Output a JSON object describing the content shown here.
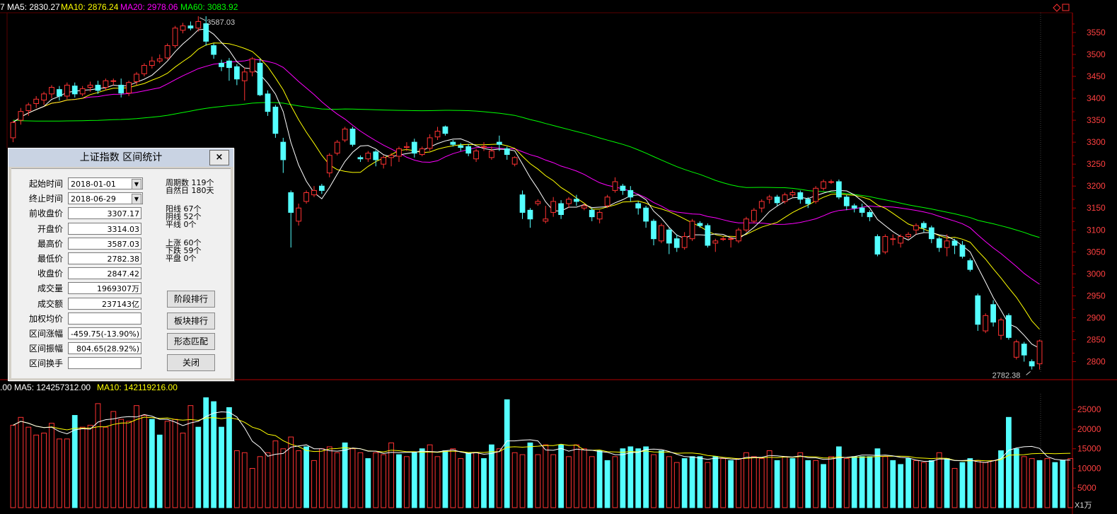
{
  "header": {
    "ma5": "7 MA5: 2830.27",
    "ma10": "MA10: 2876.24",
    "ma20": "MA20: 2978.06",
    "ma60": "MA60: 3083.92",
    "volume_line": ".00 MA5: 124257312.00",
    "volume_ma10": "MA10: 142119216.00",
    "unit_label": "X1万"
  },
  "colors": {
    "up": "#ff3232",
    "down": "#54ffff",
    "ma5": "#ffffff",
    "ma10": "#ffff00",
    "ma20": "#ff00ff",
    "ma60": "#00ff00",
    "axis": "#b00000",
    "grid": "#5a0000"
  },
  "chart_data": {
    "type": "candlestick",
    "price_axis_ticks": [
      3550,
      3500,
      3450,
      3400,
      3350,
      3300,
      3250,
      3200,
      3150,
      3100,
      3050,
      3000,
      2950,
      2900,
      2850,
      2800
    ],
    "volume_axis_ticks": [
      25000,
      20000,
      15000,
      10000,
      5000
    ],
    "volume_unit": "万",
    "annotations": {
      "high": "3587.03",
      "low": "2782.38"
    },
    "price_ylim": [
      2775,
      3595
    ],
    "volume_ylim": [
      0,
      29000
    ],
    "candles": [
      [
        3310,
        3345,
        3300,
        3348
      ],
      [
        3350,
        3370,
        3340,
        3378
      ],
      [
        3372,
        3385,
        3360,
        3390
      ],
      [
        3388,
        3398,
        3378,
        3405
      ],
      [
        3396,
        3410,
        3385,
        3415
      ],
      [
        3410,
        3425,
        3400,
        3430
      ],
      [
        3420,
        3405,
        3395,
        3428
      ],
      [
        3405,
        3430,
        3398,
        3436
      ],
      [
        3428,
        3410,
        3402,
        3436
      ],
      [
        3410,
        3422,
        3405,
        3428
      ],
      [
        3425,
        3430,
        3415,
        3438
      ],
      [
        3430,
        3418,
        3410,
        3440
      ],
      [
        3425,
        3440,
        3418,
        3445
      ],
      [
        3440,
        3440,
        3430,
        3445
      ],
      [
        3430,
        3412,
        3402,
        3445
      ],
      [
        3412,
        3436,
        3405,
        3440
      ],
      [
        3438,
        3455,
        3430,
        3460
      ],
      [
        3456,
        3475,
        3450,
        3480
      ],
      [
        3475,
        3485,
        3468,
        3495
      ],
      [
        3485,
        3490,
        3480,
        3500
      ],
      [
        3492,
        3520,
        3488,
        3525
      ],
      [
        3520,
        3560,
        3515,
        3565
      ],
      [
        3555,
        3565,
        3548,
        3572
      ],
      [
        3565,
        3560,
        3555,
        3575
      ],
      [
        3560,
        3575,
        3552,
        3587
      ],
      [
        3570,
        3530,
        3520,
        3587
      ],
      [
        3520,
        3500,
        3490,
        3525
      ],
      [
        3480,
        3472,
        3462,
        3488
      ],
      [
        3485,
        3470,
        3440,
        3492
      ],
      [
        3472,
        3444,
        3430,
        3478
      ],
      [
        3440,
        3460,
        3395,
        3470
      ],
      [
        3460,
        3490,
        3450,
        3494
      ],
      [
        3480,
        3408,
        3405,
        3490
      ],
      [
        3410,
        3370,
        3360,
        3418
      ],
      [
        3380,
        3320,
        3310,
        3385
      ],
      [
        3300,
        3260,
        3230,
        3310
      ],
      [
        3185,
        3140,
        3060,
        3190
      ],
      [
        3120,
        3150,
        3110,
        3160
      ],
      [
        3165,
        3185,
        3160,
        3190
      ],
      [
        3180,
        3190,
        3175,
        3200
      ],
      [
        3200,
        3190,
        3182,
        3205
      ],
      [
        3230,
        3270,
        3220,
        3275
      ],
      [
        3275,
        3300,
        3270,
        3305
      ],
      [
        3305,
        3330,
        3300,
        3335
      ],
      [
        3330,
        3295,
        3290,
        3335
      ],
      [
        3265,
        3262,
        3255,
        3270
      ],
      [
        3262,
        3275,
        3255,
        3280
      ],
      [
        3278,
        3260,
        3245,
        3282
      ],
      [
        3250,
        3265,
        3240,
        3270
      ],
      [
        3265,
        3270,
        3245,
        3275
      ],
      [
        3268,
        3285,
        3255,
        3290
      ],
      [
        3288,
        3290,
        3280,
        3300
      ],
      [
        3300,
        3275,
        3265,
        3308
      ],
      [
        3272,
        3285,
        3268,
        3290
      ],
      [
        3286,
        3310,
        3280,
        3318
      ],
      [
        3312,
        3325,
        3305,
        3335
      ],
      [
        3335,
        3320,
        3315,
        3338
      ],
      [
        3300,
        3295,
        3290,
        3305
      ],
      [
        3292,
        3288,
        3280,
        3298
      ],
      [
        3290,
        3275,
        3268,
        3296
      ],
      [
        3262,
        3280,
        3255,
        3285
      ],
      [
        3290,
        3290,
        3280,
        3300
      ],
      [
        3265,
        3280,
        3260,
        3290
      ],
      [
        3300,
        3295,
        3280,
        3315
      ],
      [
        3285,
        3272,
        3260,
        3290
      ],
      [
        3250,
        3265,
        3245,
        3268
      ],
      [
        3180,
        3140,
        3125,
        3190
      ],
      [
        3145,
        3125,
        3105,
        3150
      ],
      [
        3160,
        3165,
        3155,
        3170
      ],
      [
        3120,
        3125,
        3115,
        3155
      ],
      [
        3140,
        3165,
        3130,
        3175
      ],
      [
        3160,
        3135,
        3125,
        3168
      ],
      [
        3160,
        3170,
        3150,
        3175
      ],
      [
        3170,
        3165,
        3155,
        3180
      ],
      [
        3150,
        3155,
        3145,
        3160
      ],
      [
        3145,
        3130,
        3120,
        3150
      ],
      [
        3125,
        3140,
        3115,
        3145
      ],
      [
        3155,
        3175,
        3150,
        3180
      ],
      [
        3190,
        3210,
        3185,
        3220
      ],
      [
        3200,
        3190,
        3180,
        3205
      ],
      [
        3190,
        3175,
        3165,
        3200
      ],
      [
        3160,
        3150,
        3135,
        3165
      ],
      [
        3150,
        3120,
        3105,
        3155
      ],
      [
        3120,
        3080,
        3065,
        3125
      ],
      [
        3075,
        3110,
        3070,
        3115
      ],
      [
        3100,
        3070,
        3045,
        3105
      ],
      [
        3080,
        3060,
        3050,
        3090
      ],
      [
        3060,
        3085,
        3055,
        3095
      ],
      [
        3080,
        3120,
        3075,
        3125
      ],
      [
        3115,
        3110,
        3105,
        3120
      ],
      [
        3110,
        3065,
        3060,
        3115
      ],
      [
        3070,
        3075,
        3050,
        3080
      ],
      [
        3080,
        3080,
        3075,
        3085
      ],
      [
        3080,
        3080,
        3060,
        3085
      ],
      [
        3075,
        3100,
        3070,
        3105
      ],
      [
        3100,
        3125,
        3095,
        3130
      ],
      [
        3120,
        3145,
        3115,
        3150
      ],
      [
        3150,
        3165,
        3140,
        3170
      ],
      [
        3170,
        3175,
        3160,
        3180
      ],
      [
        3175,
        3162,
        3155,
        3180
      ],
      [
        3165,
        3180,
        3160,
        3185
      ],
      [
        3180,
        3185,
        3175,
        3190
      ],
      [
        3185,
        3170,
        3160,
        3190
      ],
      [
        3170,
        3160,
        3150,
        3175
      ],
      [
        3165,
        3195,
        3160,
        3200
      ],
      [
        3195,
        3210,
        3190,
        3215
      ],
      [
        3210,
        3210,
        3205,
        3215
      ],
      [
        3210,
        3175,
        3170,
        3215
      ],
      [
        3175,
        3155,
        3145,
        3180
      ],
      [
        3155,
        3150,
        3140,
        3160
      ],
      [
        3150,
        3140,
        3130,
        3160
      ],
      [
        3140,
        3130,
        3120,
        3145
      ],
      [
        3085,
        3045,
        3040,
        3090
      ],
      [
        3050,
        3085,
        3045,
        3090
      ],
      [
        3080,
        3080,
        3065,
        3090
      ],
      [
        3070,
        3085,
        3060,
        3090
      ],
      [
        3085,
        3090,
        3080,
        3095
      ],
      [
        3100,
        3110,
        3090,
        3115
      ],
      [
        3115,
        3105,
        3095,
        3120
      ],
      [
        3105,
        3080,
        3070,
        3110
      ],
      [
        3080,
        3060,
        3050,
        3085
      ],
      [
        3060,
        3075,
        3040,
        3090
      ],
      [
        3075,
        3065,
        3045,
        3080
      ],
      [
        3065,
        3040,
        3035,
        3075
      ],
      [
        3030,
        3010,
        3005,
        3035
      ],
      [
        2950,
        2885,
        2870,
        2955
      ],
      [
        2870,
        2905,
        2865,
        2910
      ],
      [
        2930,
        2890,
        2880,
        2940
      ],
      [
        2860,
        2895,
        2850,
        2900
      ],
      [
        2905,
        2855,
        2850,
        2910
      ],
      [
        2810,
        2845,
        2805,
        2850
      ],
      [
        2840,
        2815,
        2800,
        2845
      ],
      [
        2800,
        2790,
        2782,
        2805
      ],
      [
        2795,
        2847,
        2782,
        2850
      ]
    ],
    "volumes": [
      [
        21000,
        1
      ],
      [
        23000,
        1
      ],
      [
        20500,
        1
      ],
      [
        18500,
        1
      ],
      [
        19000,
        1
      ],
      [
        21500,
        1
      ],
      [
        17500,
        1
      ],
      [
        17500,
        1
      ],
      [
        23500,
        0
      ],
      [
        20500,
        1
      ],
      [
        21000,
        1
      ],
      [
        26500,
        1
      ],
      [
        20500,
        1
      ],
      [
        24500,
        1
      ],
      [
        22500,
        1
      ],
      [
        22000,
        1
      ],
      [
        26000,
        1
      ],
      [
        23500,
        1
      ],
      [
        22500,
        0
      ],
      [
        18500,
        0
      ],
      [
        22000,
        1
      ],
      [
        22500,
        1
      ],
      [
        19000,
        1
      ],
      [
        26000,
        1
      ],
      [
        20500,
        0
      ],
      [
        28000,
        0
      ],
      [
        27000,
        0
      ],
      [
        20500,
        0
      ],
      [
        25500,
        0
      ],
      [
        14500,
        1
      ],
      [
        14000,
        1
      ],
      [
        10000,
        1
      ],
      [
        13000,
        1
      ],
      [
        14000,
        1
      ],
      [
        17000,
        1
      ],
      [
        15000,
        1
      ],
      [
        18000,
        1
      ],
      [
        14500,
        1
      ],
      [
        15500,
        0
      ],
      [
        12000,
        1
      ],
      [
        15000,
        1
      ],
      [
        15500,
        1
      ],
      [
        14000,
        1
      ],
      [
        16500,
        0
      ],
      [
        15000,
        1
      ],
      [
        14000,
        1
      ],
      [
        12500,
        0
      ],
      [
        14000,
        1
      ],
      [
        13500,
        1
      ],
      [
        16500,
        1
      ],
      [
        13500,
        0
      ],
      [
        13000,
        1
      ],
      [
        14000,
        0
      ],
      [
        15000,
        0
      ],
      [
        16000,
        1
      ],
      [
        13000,
        1
      ],
      [
        14500,
        0
      ],
      [
        15000,
        1
      ],
      [
        12500,
        1
      ],
      [
        14000,
        0
      ],
      [
        14000,
        1
      ],
      [
        12500,
        0
      ],
      [
        16000,
        0
      ],
      [
        15000,
        1
      ],
      [
        27500,
        0
      ],
      [
        14000,
        1
      ],
      [
        13500,
        1
      ],
      [
        16500,
        0
      ],
      [
        13500,
        1
      ],
      [
        16000,
        1
      ],
      [
        13500,
        1
      ],
      [
        16000,
        0
      ],
      [
        13000,
        1
      ],
      [
        16000,
        1
      ],
      [
        15000,
        1
      ],
      [
        13000,
        1
      ],
      [
        14500,
        0
      ],
      [
        12000,
        0
      ],
      [
        13000,
        1
      ],
      [
        15000,
        0
      ],
      [
        15500,
        0
      ],
      [
        15000,
        0
      ],
      [
        15500,
        0
      ],
      [
        13500,
        1
      ],
      [
        14500,
        0
      ],
      [
        13000,
        1
      ],
      [
        11500,
        1
      ],
      [
        12500,
        0
      ],
      [
        13000,
        0
      ],
      [
        13000,
        0
      ],
      [
        11500,
        1
      ],
      [
        13000,
        0
      ],
      [
        12500,
        1
      ],
      [
        12000,
        0
      ],
      [
        12500,
        1
      ],
      [
        14000,
        1
      ],
      [
        13000,
        1
      ],
      [
        12500,
        1
      ],
      [
        14500,
        1
      ],
      [
        12000,
        0
      ],
      [
        13000,
        1
      ],
      [
        12500,
        0
      ],
      [
        14000,
        1
      ],
      [
        12000,
        0
      ],
      [
        12000,
        1
      ],
      [
        11000,
        0
      ],
      [
        13000,
        1
      ],
      [
        15500,
        0
      ],
      [
        12500,
        1
      ],
      [
        13000,
        0
      ],
      [
        13000,
        0
      ],
      [
        13000,
        0
      ],
      [
        15000,
        0
      ],
      [
        13000,
        1
      ],
      [
        12000,
        0
      ],
      [
        11000,
        0
      ],
      [
        12500,
        0
      ],
      [
        12000,
        1
      ],
      [
        11500,
        1
      ],
      [
        12000,
        0
      ],
      [
        14000,
        1
      ],
      [
        12500,
        0
      ],
      [
        10000,
        1
      ],
      [
        11500,
        0
      ],
      [
        12500,
        0
      ],
      [
        12000,
        1
      ],
      [
        11500,
        1
      ],
      [
        12000,
        1
      ],
      [
        14500,
        0
      ],
      [
        23000,
        0
      ],
      [
        15000,
        0
      ],
      [
        13000,
        1
      ],
      [
        12500,
        1
      ],
      [
        12000,
        0
      ],
      [
        12500,
        1
      ],
      [
        11500,
        0
      ],
      [
        12000,
        0
      ],
      [
        12500,
        1
      ]
    ]
  },
  "panel": {
    "title": "上证指数 区间统计",
    "close": "×",
    "rows": [
      {
        "label": "起始时间",
        "value": "2018-01-01",
        "select": true
      },
      {
        "label": "终止时间",
        "value": "2018-06-29",
        "select": true
      },
      {
        "label": "前收盘价",
        "value": "3307.17"
      },
      {
        "label": "开盘价",
        "value": "3314.03"
      },
      {
        "label": "最高价",
        "value": "3587.03"
      },
      {
        "label": "最低价",
        "value": "2782.38"
      },
      {
        "label": "收盘价",
        "value": "2847.42"
      },
      {
        "label": "成交量",
        "value": "1969307万"
      },
      {
        "label": "成交额",
        "value": "237143亿"
      },
      {
        "label": "加权均价",
        "value": ""
      },
      {
        "label": "区间涨幅",
        "value": "-459.75(-13.90%)"
      },
      {
        "label": "区间振幅",
        "value": "804.65(28.92%)"
      },
      {
        "label": "区间换手",
        "value": ""
      }
    ],
    "stats": [
      "周期数 119个",
      "自然日 180天",
      "阳线 67个",
      "阴线 52个",
      "平线 0个",
      "上涨 60个",
      "下跌 59个",
      "平盘 0个"
    ],
    "buttons": [
      "阶段排行",
      "板块排行",
      "形态匹配",
      "关闭"
    ]
  }
}
